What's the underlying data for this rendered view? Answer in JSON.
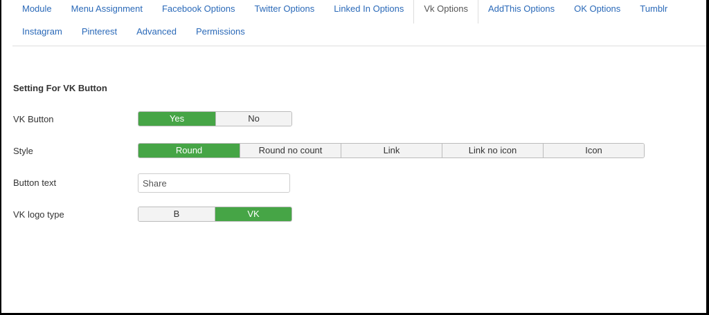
{
  "tabs": {
    "row1": [
      "Module",
      "Menu Assignment",
      "Facebook Options",
      "Twitter Options",
      "Linked In Options",
      "Vk Options",
      "AddThis Options",
      "OK Options",
      "Tumblr"
    ],
    "row2": [
      "Instagram",
      "Pinterest",
      "Advanced",
      "Permissions"
    ],
    "active": "Vk Options"
  },
  "section": {
    "title": "Setting For VK Button"
  },
  "fields": {
    "vk_button": {
      "label": "VK Button",
      "options": [
        "Yes",
        "No"
      ],
      "selected": "Yes"
    },
    "style": {
      "label": "Style",
      "options": [
        "Round",
        "Round no count",
        "Link",
        "Link no icon",
        "Icon"
      ],
      "selected": "Round"
    },
    "button_text": {
      "label": "Button text",
      "value": "Share"
    },
    "logo_type": {
      "label": "VK logo type",
      "options": [
        "B",
        "VK"
      ],
      "selected": "VK"
    }
  },
  "colors": {
    "link": "#2a69b8",
    "selected": "#46a546"
  }
}
